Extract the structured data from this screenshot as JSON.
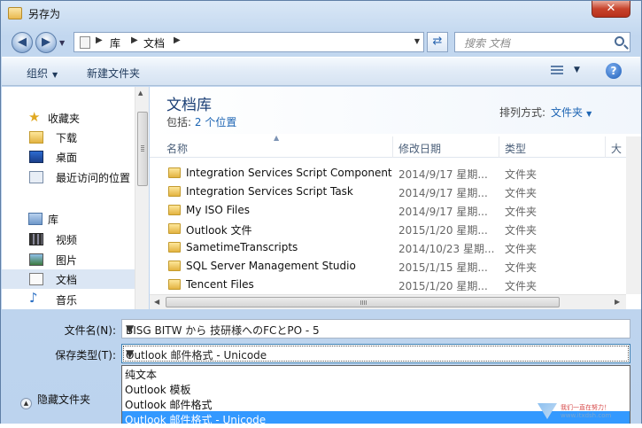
{
  "window": {
    "title": "另存为",
    "close_label": "✕"
  },
  "navigation": {
    "back": "◀",
    "forward": "▶",
    "breadcrumb": [
      "库",
      "文档"
    ],
    "search_placeholder": "搜索 文档"
  },
  "toolbar": {
    "organize": "组织",
    "new_folder": "新建文件夹",
    "help": "?"
  },
  "nav_pane": {
    "items": [
      {
        "label": "收藏夹",
        "icon": "star-icon",
        "group": true
      },
      {
        "label": "下载",
        "icon": "download-folder-icon"
      },
      {
        "label": "桌面",
        "icon": "desktop-icon"
      },
      {
        "label": "最近访问的位置",
        "icon": "recent-places-icon"
      },
      {
        "label": "库",
        "icon": "library-icon",
        "group": true
      },
      {
        "label": "视频",
        "icon": "video-icon"
      },
      {
        "label": "图片",
        "icon": "pictures-icon"
      },
      {
        "label": "文档",
        "icon": "documents-icon",
        "selected": true
      },
      {
        "label": "音乐",
        "icon": "music-icon"
      }
    ]
  },
  "library": {
    "title": "文档库",
    "includes_label": "包括:",
    "includes_link": "2 个位置",
    "arrange_label": "排列方式:",
    "arrange_value": "文件夹"
  },
  "columns": [
    "名称",
    "修改日期",
    "类型",
    "大"
  ],
  "files": [
    {
      "name": "Integration Services Script Component",
      "date": "2014/9/17 星期...",
      "type": "文件夹"
    },
    {
      "name": "Integration Services Script Task",
      "date": "2014/9/17 星期...",
      "type": "文件夹"
    },
    {
      "name": "My ISO Files",
      "date": "2014/9/17 星期...",
      "type": "文件夹"
    },
    {
      "name": "Outlook 文件",
      "date": "2015/1/20 星期...",
      "type": "文件夹"
    },
    {
      "name": "SametimeTranscripts",
      "date": "2014/10/23 星期...",
      "type": "文件夹"
    },
    {
      "name": "SQL Server Management Studio",
      "date": "2015/1/15 星期...",
      "type": "文件夹"
    },
    {
      "name": "Tencent Files",
      "date": "2015/1/20 星期...",
      "type": "文件夹"
    }
  ],
  "form": {
    "filename_label": "文件名(N):",
    "filename_value": "BISG BITW から 技研様へのFCとPO - 5",
    "filetype_label": "保存类型(T):",
    "filetype_value": "Outlook 邮件格式 - Unicode",
    "filetype_options": [
      "纯文本",
      "Outlook 模板",
      "Outlook 邮件格式",
      "Outlook 邮件格式 - Unicode"
    ],
    "selected_option": 3,
    "hide_folders": "隐藏文件夹"
  },
  "watermark": {
    "line1": "我们一直在努力！",
    "line2": "www.itxdsh.com"
  }
}
